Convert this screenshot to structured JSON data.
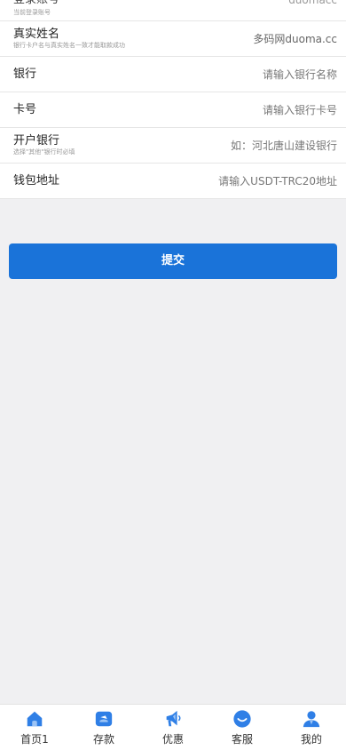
{
  "form": {
    "rows": [
      {
        "label": "登录账号",
        "sub": "当前登录账号",
        "value": "duomacc"
      },
      {
        "label": "真实姓名",
        "sub": "银行卡户名与真实姓名一致才能取款成功",
        "value": "多码网duoma.cc"
      },
      {
        "label": "银行",
        "placeholder": "请输入银行名称"
      },
      {
        "label": "卡号",
        "placeholder": "请输入银行卡号"
      },
      {
        "label": "开户银行",
        "sub": "选择\"其他\"银行时必填",
        "placeholder": "如：河北唐山建设银行"
      },
      {
        "label": "钱包地址",
        "placeholder": "请输入USDT-TRC20地址"
      }
    ],
    "submit_label": "提交"
  },
  "tabbar": {
    "items": [
      {
        "label": "首页1",
        "icon": "home-icon"
      },
      {
        "label": "存款",
        "icon": "wallet-icon"
      },
      {
        "label": "优惠",
        "icon": "megaphone-icon"
      },
      {
        "label": "客服",
        "icon": "chat-icon"
      },
      {
        "label": "我的",
        "icon": "user-icon"
      }
    ]
  },
  "colors": {
    "accent": "#1a73d9",
    "icon_blue": "#2f7fe6",
    "background": "#f0f0f2"
  }
}
